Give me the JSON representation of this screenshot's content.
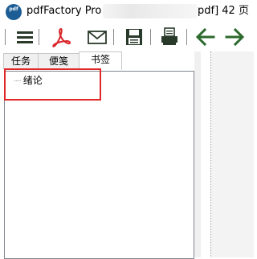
{
  "window": {
    "app_icon_text": "pdf",
    "title_prefix": "pdfFactory Pro -",
    "title_suffix": "pdf] 42 页"
  },
  "toolbar": {
    "buttons": [
      "menu-icon",
      "acrobat-icon",
      "mail-icon",
      "save-icon",
      "print-icon",
      "back-arrow-icon",
      "forward-arrow-icon"
    ],
    "accent_color": "#2d6a2d",
    "pdf_color": "#d9262b"
  },
  "tabs": [
    {
      "label": "任务",
      "active": false
    },
    {
      "label": "便笺",
      "active": false
    },
    {
      "label": "书签",
      "active": true
    }
  ],
  "bookmarks": [
    {
      "label": "绪论"
    }
  ],
  "highlight_color": "#e0282a"
}
